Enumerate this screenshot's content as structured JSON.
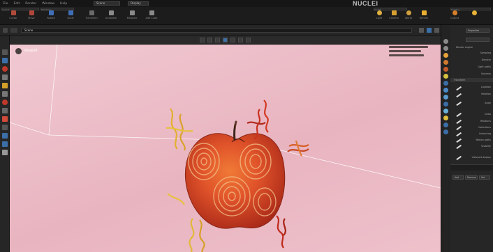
{
  "app": {
    "title": "NUCLEI",
    "accent": "#3c6fa8"
  },
  "menubar": {
    "items": [
      "File",
      "Edit",
      "Render",
      "Window",
      "Help"
    ],
    "fields": [
      "Scene",
      "Display"
    ]
  },
  "ribbon": {
    "tabs": [
      "Layout",
      "Modeling",
      "Sculpt",
      "Shading"
    ],
    "buttons": [
      {
        "label": "Cursor",
        "color": "#b04a3a"
      },
      {
        "label": "Move",
        "color": "#3f6fb8"
      },
      {
        "label": "Rotate",
        "color": "#3f6fb8"
      },
      {
        "label": "Scale",
        "color": "#8a8a8a"
      },
      {
        "label": "Transform",
        "color": "#8a8a8a"
      },
      {
        "label": "Annotate",
        "color": "#8a8a8a"
      },
      {
        "label": "Measure",
        "color": "#8a8a8a"
      },
      {
        "label": "Add Cube",
        "color": "#8a8a8a"
      },
      {
        "label": "Light",
        "color": "#e0b040"
      },
      {
        "label": "Camera",
        "color": "#d8a030"
      },
      {
        "label": "World",
        "color": "#d0a040"
      },
      {
        "label": "Render",
        "color": "#e8b030"
      },
      {
        "label": "Output",
        "color": "#d67e2a"
      }
    ]
  },
  "header": {
    "path": "Scene"
  },
  "viewport": {
    "label": "Viewport",
    "background": "#eec0cb"
  },
  "properties": {
    "header": "Properties",
    "section1_title": "Render engine",
    "rows1": [
      "Sampling",
      "Denoise",
      "Light paths",
      "Volumes",
      "Film"
    ],
    "section2_title": "Transform",
    "rows2": [
      "Location",
      "Rotation",
      "Scale",
      "Delta",
      "Relations",
      "Collections",
      "Instancing",
      "Motion paths",
      "Visibility",
      "Viewport display"
    ],
    "footer_buttons": [
      "Add",
      "Remove",
      "Set"
    ]
  }
}
